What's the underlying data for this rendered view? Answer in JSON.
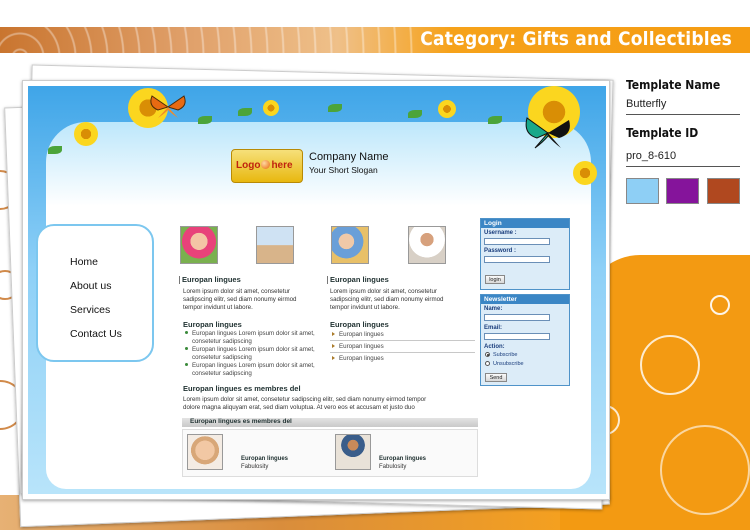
{
  "banner": {
    "category": "Category: Gifts and Collectibles"
  },
  "template": {
    "name_label": "Template Name",
    "name_value": "Butterfly",
    "id_label": "Template ID",
    "id_value": "pro_8-610",
    "swatches": [
      "#8ecff5",
      "#85149b",
      "#b0481f"
    ]
  },
  "preview": {
    "logo_text_a": "Logo",
    "logo_text_b": "here",
    "company_name": "Company Name",
    "slogan": "Your Short Slogan",
    "nav": [
      "Home",
      "About us",
      "Services",
      "Contact Us"
    ],
    "col1_heading": "Europan lingues",
    "col1_text_1": "Lorem ipsum dolor sit amet, consetetur",
    "col1_text_2": "sadipscing elitr, sed diam nonumy eirmod",
    "col1_text_3": "tempor invidunt ut labore.",
    "col2_heading": "Europan lingues",
    "col2_text_1": "Lorem ipsum dolor sit amet, consetetur",
    "col2_text_2": "sadipscing elitr, sed diam nonumy eirmod",
    "col2_text_3": "tempor invidunt ut labore.",
    "list1_heading": "Europan lingues",
    "list1": [
      [
        "Europan lingues Lorem ipsum dolor sit amet,",
        "consetetur sadipscing"
      ],
      [
        "Europan lingues Lorem ipsum dolor sit amet,",
        "consetetur sadipscing"
      ],
      [
        "Europan lingues Lorem ipsum dolor sit amet,",
        "consetetur sadipscing"
      ]
    ],
    "list2_heading": "Europan lingues",
    "list2": [
      "Europan lingues",
      "Europan lingues",
      "Europan lingues"
    ],
    "members_heading": "Europan lingues es membres del",
    "members_text_1": "Lorem ipsum dolor sit amet, consetetur sadipscing elitr, sed diam nonumy eirmod tempor",
    "members_text_2": "dolore magna aliquyam erat, sed diam voluptua. At vero eos et accusam et justo duo",
    "band_heading": "Europan lingues es membres del",
    "bottom_items": [
      {
        "title": "Europan lingues",
        "sub": "Fabulosity"
      },
      {
        "title": "Europan lingues",
        "sub": "Fabulosity"
      }
    ],
    "login": {
      "title": "Login",
      "username_label": "Username :",
      "password_label": "Password :",
      "button": "login"
    },
    "newsletter": {
      "title": "Newsletter",
      "name_label": "Name:",
      "email_label": "Email:",
      "action_label": "Action:",
      "subscribe": "Subscribe",
      "unsubscribe": "Unsubscribe",
      "button": "Send"
    }
  }
}
